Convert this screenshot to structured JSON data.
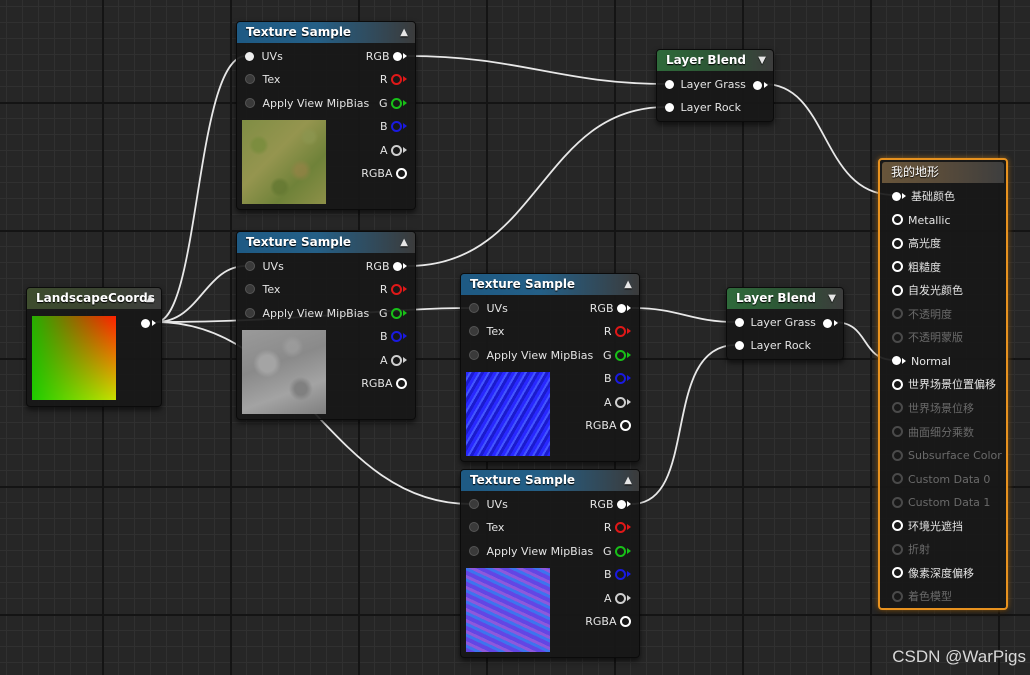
{
  "colors": {
    "pin_r": "#e01818",
    "pin_g": "#18c018",
    "pin_b": "#1a1ae0",
    "pin_a": "#d0d0d0",
    "selected": "#e8921f"
  },
  "texture_pins": {
    "uvs": "UVs",
    "tex": "Tex",
    "mipbias": "Apply View MipBias",
    "rgb": "RGB",
    "r": "R",
    "g": "G",
    "b": "B",
    "a": "A",
    "rgba": "RGBA"
  },
  "texture_samples": [
    {
      "title": "Texture Sample",
      "thumbnail": "grass"
    },
    {
      "title": "Texture Sample",
      "thumbnail": "rock"
    },
    {
      "title": "Texture Sample",
      "thumbnail": "normal-map"
    },
    {
      "title": "Texture Sample",
      "thumbnail": "normal-map"
    }
  ],
  "layer_blends": [
    {
      "title": "Layer Blend",
      "in_grass": "Layer Grass",
      "in_rock": "Layer Rock"
    },
    {
      "title": "Layer Blend",
      "in_grass": "Layer Grass",
      "in_rock": "Layer Rock"
    }
  ],
  "landscape_coords": {
    "title": "LandscapeCoords"
  },
  "material": {
    "title": "我的地形",
    "inputs": [
      {
        "label": "基础颜色",
        "state": "connected"
      },
      {
        "label": "Metallic",
        "state": "active"
      },
      {
        "label": "高光度",
        "state": "active"
      },
      {
        "label": "粗糙度",
        "state": "active"
      },
      {
        "label": "自发光颜色",
        "state": "active"
      },
      {
        "label": "不透明度",
        "state": "disabled"
      },
      {
        "label": "不透明蒙版",
        "state": "disabled"
      },
      {
        "label": "Normal",
        "state": "connected"
      },
      {
        "label": "世界场景位置偏移",
        "state": "active"
      },
      {
        "label": "世界场景位移",
        "state": "disabled"
      },
      {
        "label": "曲面细分乘数",
        "state": "disabled"
      },
      {
        "label": "Subsurface Color",
        "state": "disabled"
      },
      {
        "label": "Custom Data 0",
        "state": "disabled"
      },
      {
        "label": "Custom Data 1",
        "state": "disabled"
      },
      {
        "label": "环境光遮挡",
        "state": "active"
      },
      {
        "label": "折射",
        "state": "disabled"
      },
      {
        "label": "像素深度偏移",
        "state": "active"
      },
      {
        "label": "着色模型",
        "state": "disabled"
      }
    ]
  },
  "watermark": "CSDN @WarPigs"
}
